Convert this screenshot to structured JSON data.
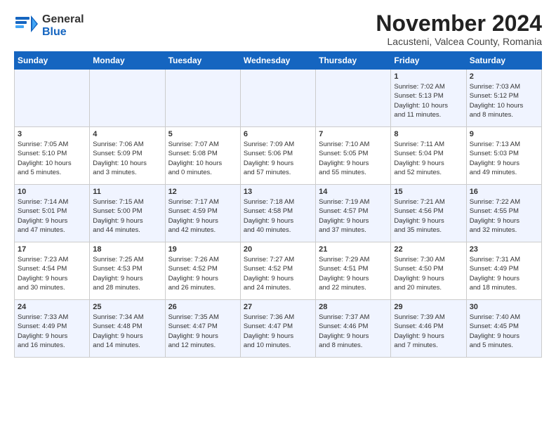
{
  "header": {
    "logo_general": "General",
    "logo_blue": "Blue",
    "month": "November 2024",
    "location": "Lacusteni, Valcea County, Romania"
  },
  "days_of_week": [
    "Sunday",
    "Monday",
    "Tuesday",
    "Wednesday",
    "Thursday",
    "Friday",
    "Saturday"
  ],
  "weeks": [
    [
      {
        "day": "",
        "info": ""
      },
      {
        "day": "",
        "info": ""
      },
      {
        "day": "",
        "info": ""
      },
      {
        "day": "",
        "info": ""
      },
      {
        "day": "",
        "info": ""
      },
      {
        "day": "1",
        "info": "Sunrise: 7:02 AM\nSunset: 5:13 PM\nDaylight: 10 hours\nand 11 minutes."
      },
      {
        "day": "2",
        "info": "Sunrise: 7:03 AM\nSunset: 5:12 PM\nDaylight: 10 hours\nand 8 minutes."
      }
    ],
    [
      {
        "day": "3",
        "info": "Sunrise: 7:05 AM\nSunset: 5:10 PM\nDaylight: 10 hours\nand 5 minutes."
      },
      {
        "day": "4",
        "info": "Sunrise: 7:06 AM\nSunset: 5:09 PM\nDaylight: 10 hours\nand 3 minutes."
      },
      {
        "day": "5",
        "info": "Sunrise: 7:07 AM\nSunset: 5:08 PM\nDaylight: 10 hours\nand 0 minutes."
      },
      {
        "day": "6",
        "info": "Sunrise: 7:09 AM\nSunset: 5:06 PM\nDaylight: 9 hours\nand 57 minutes."
      },
      {
        "day": "7",
        "info": "Sunrise: 7:10 AM\nSunset: 5:05 PM\nDaylight: 9 hours\nand 55 minutes."
      },
      {
        "day": "8",
        "info": "Sunrise: 7:11 AM\nSunset: 5:04 PM\nDaylight: 9 hours\nand 52 minutes."
      },
      {
        "day": "9",
        "info": "Sunrise: 7:13 AM\nSunset: 5:03 PM\nDaylight: 9 hours\nand 49 minutes."
      }
    ],
    [
      {
        "day": "10",
        "info": "Sunrise: 7:14 AM\nSunset: 5:01 PM\nDaylight: 9 hours\nand 47 minutes."
      },
      {
        "day": "11",
        "info": "Sunrise: 7:15 AM\nSunset: 5:00 PM\nDaylight: 9 hours\nand 44 minutes."
      },
      {
        "day": "12",
        "info": "Sunrise: 7:17 AM\nSunset: 4:59 PM\nDaylight: 9 hours\nand 42 minutes."
      },
      {
        "day": "13",
        "info": "Sunrise: 7:18 AM\nSunset: 4:58 PM\nDaylight: 9 hours\nand 40 minutes."
      },
      {
        "day": "14",
        "info": "Sunrise: 7:19 AM\nSunset: 4:57 PM\nDaylight: 9 hours\nand 37 minutes."
      },
      {
        "day": "15",
        "info": "Sunrise: 7:21 AM\nSunset: 4:56 PM\nDaylight: 9 hours\nand 35 minutes."
      },
      {
        "day": "16",
        "info": "Sunrise: 7:22 AM\nSunset: 4:55 PM\nDaylight: 9 hours\nand 32 minutes."
      }
    ],
    [
      {
        "day": "17",
        "info": "Sunrise: 7:23 AM\nSunset: 4:54 PM\nDaylight: 9 hours\nand 30 minutes."
      },
      {
        "day": "18",
        "info": "Sunrise: 7:25 AM\nSunset: 4:53 PM\nDaylight: 9 hours\nand 28 minutes."
      },
      {
        "day": "19",
        "info": "Sunrise: 7:26 AM\nSunset: 4:52 PM\nDaylight: 9 hours\nand 26 minutes."
      },
      {
        "day": "20",
        "info": "Sunrise: 7:27 AM\nSunset: 4:52 PM\nDaylight: 9 hours\nand 24 minutes."
      },
      {
        "day": "21",
        "info": "Sunrise: 7:29 AM\nSunset: 4:51 PM\nDaylight: 9 hours\nand 22 minutes."
      },
      {
        "day": "22",
        "info": "Sunrise: 7:30 AM\nSunset: 4:50 PM\nDaylight: 9 hours\nand 20 minutes."
      },
      {
        "day": "23",
        "info": "Sunrise: 7:31 AM\nSunset: 4:49 PM\nDaylight: 9 hours\nand 18 minutes."
      }
    ],
    [
      {
        "day": "24",
        "info": "Sunrise: 7:33 AM\nSunset: 4:49 PM\nDaylight: 9 hours\nand 16 minutes."
      },
      {
        "day": "25",
        "info": "Sunrise: 7:34 AM\nSunset: 4:48 PM\nDaylight: 9 hours\nand 14 minutes."
      },
      {
        "day": "26",
        "info": "Sunrise: 7:35 AM\nSunset: 4:47 PM\nDaylight: 9 hours\nand 12 minutes."
      },
      {
        "day": "27",
        "info": "Sunrise: 7:36 AM\nSunset: 4:47 PM\nDaylight: 9 hours\nand 10 minutes."
      },
      {
        "day": "28",
        "info": "Sunrise: 7:37 AM\nSunset: 4:46 PM\nDaylight: 9 hours\nand 8 minutes."
      },
      {
        "day": "29",
        "info": "Sunrise: 7:39 AM\nSunset: 4:46 PM\nDaylight: 9 hours\nand 7 minutes."
      },
      {
        "day": "30",
        "info": "Sunrise: 7:40 AM\nSunset: 4:45 PM\nDaylight: 9 hours\nand 5 minutes."
      }
    ]
  ]
}
